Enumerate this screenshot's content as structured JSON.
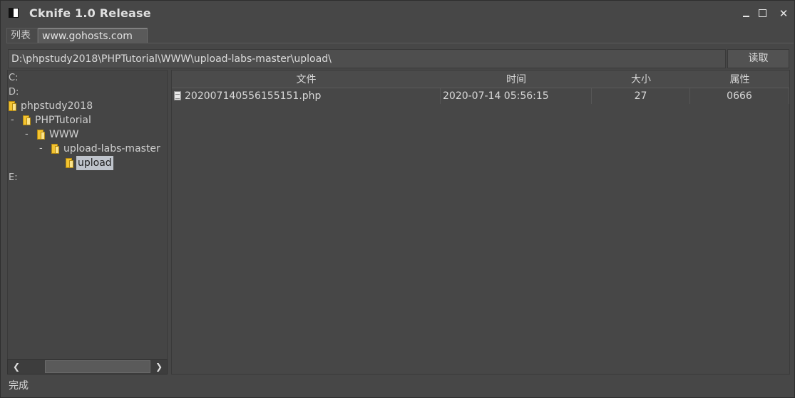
{
  "window": {
    "title": "Cknife 1.0 Release"
  },
  "tabs": [
    {
      "label": "列表"
    },
    {
      "label": "www.gohosts.com"
    }
  ],
  "path": {
    "value": "D:\\phpstudy2018\\PHPTutorial\\WWW\\upload-labs-master\\upload\\"
  },
  "read_button": "读取",
  "tree": {
    "drive_c": "C:",
    "drive_d": "D:",
    "folders": [
      {
        "label": "phpstudy2018",
        "toggle": ""
      },
      {
        "label": "PHPTutorial",
        "toggle": "-"
      },
      {
        "label": "WWW",
        "toggle": "-"
      },
      {
        "label": "upload-labs-master",
        "toggle": "-"
      },
      {
        "label": "upload",
        "toggle": "",
        "selected": true
      }
    ],
    "drive_e": "E:"
  },
  "table": {
    "columns": [
      "文件",
      "时间",
      "大小",
      "属性"
    ],
    "rows": [
      {
        "name": "202007140556155151.php",
        "time": "2020-07-14 05:56:15",
        "size": "27",
        "attr": "0666"
      }
    ]
  },
  "status": "完成",
  "icons": {
    "app": "cknife-app-icon",
    "folder": "folder-icon",
    "file": "file-icon"
  }
}
